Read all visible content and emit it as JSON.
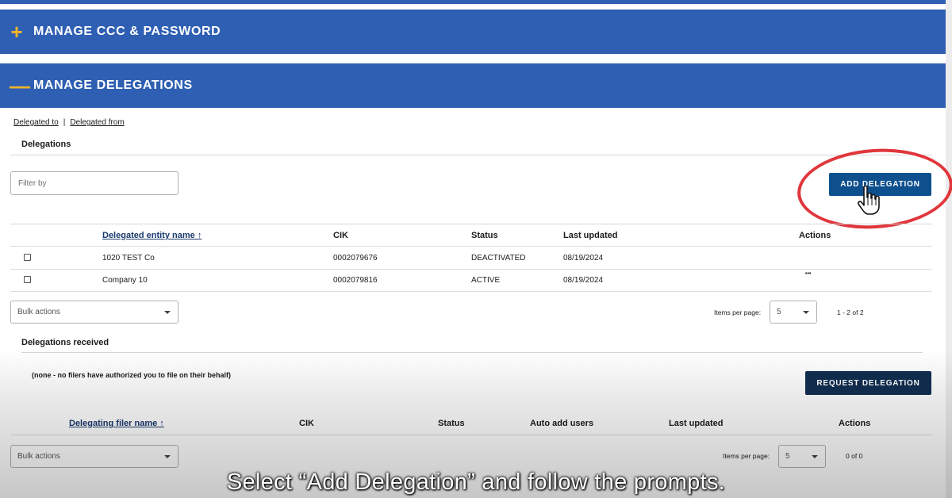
{
  "accordions": {
    "manage_ccc": {
      "sign": "+",
      "title": "MANAGE CCC & PASSWORD"
    },
    "manage_delegations": {
      "sign": "—",
      "title": "MANAGE DELEGATIONS"
    }
  },
  "nav_links": {
    "delegated_to": "Delegated to",
    "separator": "|",
    "delegated_from": "Delegated from"
  },
  "delegations": {
    "heading": "Delegations",
    "filter_placeholder": "Filter by",
    "add_button": "ADD DELEGATION",
    "columns": {
      "entity_name": "Delegated entity name ↑",
      "cik": "CIK",
      "status": "Status",
      "last_updated": "Last updated",
      "actions": "Actions"
    },
    "rows": [
      {
        "name": "1020 TEST Co",
        "cik": "0002079676",
        "status": "DEACTIVATED",
        "last_updated": "08/19/2024",
        "actions": ""
      },
      {
        "name": "Company 10",
        "cik": "0002079816",
        "status": "ACTIVE",
        "last_updated": "08/19/2024",
        "actions": "•••"
      }
    ],
    "bulk_actions": "Bulk actions",
    "items_per_page_label": "Items per page:",
    "items_per_page_value": "5",
    "range": "1 - 2 of 2"
  },
  "received": {
    "heading": "Delegations received",
    "none_text": "(none - no filers have authorized you to file on their behalf)",
    "request_button": "REQUEST DELEGATION",
    "columns": {
      "filer_name": "Delegating filer name ↑",
      "cik": "CIK",
      "status": "Status",
      "auto_add": "Auto add users",
      "last_updated": "Last updated",
      "actions": "Actions"
    },
    "bulk_actions": "Bulk actions",
    "items_per_page_label": "Items per page:",
    "items_per_page_value": "5",
    "range": "0 of 0"
  },
  "caption": "Select “Add Delegation” and follow the prompts.",
  "colors": {
    "accent_blue": "#2f5fb3",
    "button_blue": "#0e4f8e",
    "button_navy": "#112e51",
    "highlight_red": "#e0363c",
    "accordion_sign": "#f0b429"
  }
}
